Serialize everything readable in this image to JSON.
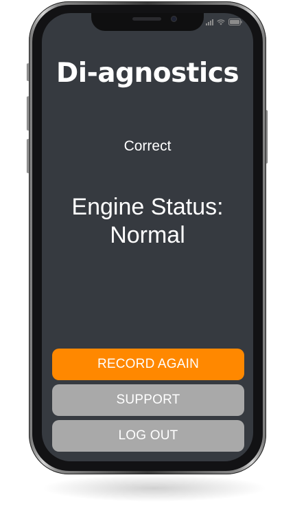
{
  "app": {
    "title": "Di-agnostics"
  },
  "result": {
    "label": "Correct",
    "status_line1": "Engine Status:",
    "status_line2": "Normal"
  },
  "buttons": {
    "record_again": "RECORD AGAIN",
    "support": "SUPPORT",
    "log_out": "LOG OUT"
  },
  "status_bar": {
    "icons": [
      "signal-icon",
      "wifi-icon",
      "battery-icon"
    ]
  },
  "colors": {
    "screen_background": "#363a40",
    "primary_button": "#ff8800",
    "secondary_button": "#a9a9a9",
    "text": "#ffffff"
  }
}
